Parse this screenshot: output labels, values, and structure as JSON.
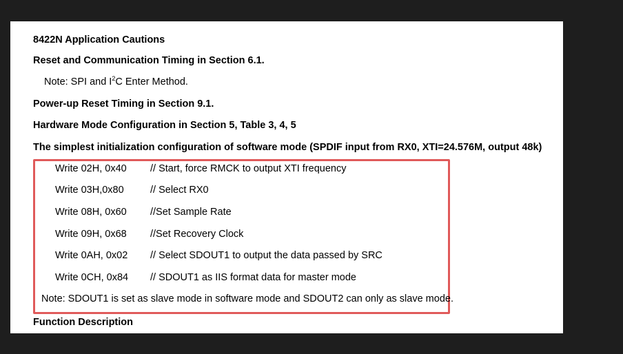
{
  "document": {
    "title": "8422N Application Cautions",
    "section_reset": "Reset and Communication Timing in Section 6.1.",
    "note_spi": {
      "prefix": "Note: SPI and I",
      "sup": "2",
      "suffix": "C Enter Method."
    },
    "section_powerup": "Power-up Reset Timing in Section 9.1.",
    "section_hardware": "Hardware Mode Configuration in Section 5, Table 3, 4, 5",
    "section_init": "The simplest initialization configuration of software mode (SPDIF input from RX0, XTI=24.576M, output 48k)",
    "commands": [
      {
        "cmd": "Write 02H, 0x40",
        "comment": "// Start, force RMCK to output XTI frequency"
      },
      {
        "cmd": "Write 03H,0x80",
        "comment": "// Select RX0"
      },
      {
        "cmd": "Write 08H, 0x60",
        "comment": "//Set Sample Rate"
      },
      {
        "cmd": "Write 09H, 0x68",
        "comment": "//Set Recovery Clock"
      },
      {
        "cmd": "Write 0AH, 0x02",
        "comment": "// Select SDOUT1 to output the data passed by SRC"
      },
      {
        "cmd": "Write 0CH, 0x84",
        "comment": "// SDOUT1 as IIS format data for master mode"
      }
    ],
    "note_slave": "Note: SDOUT1 is set as slave mode in software mode and SDOUT2 can only as slave mode.",
    "section_function": "Function Description"
  },
  "colors": {
    "background": "#1e1e1e",
    "page": "#ffffff",
    "highlight_border": "#e05a5a"
  }
}
